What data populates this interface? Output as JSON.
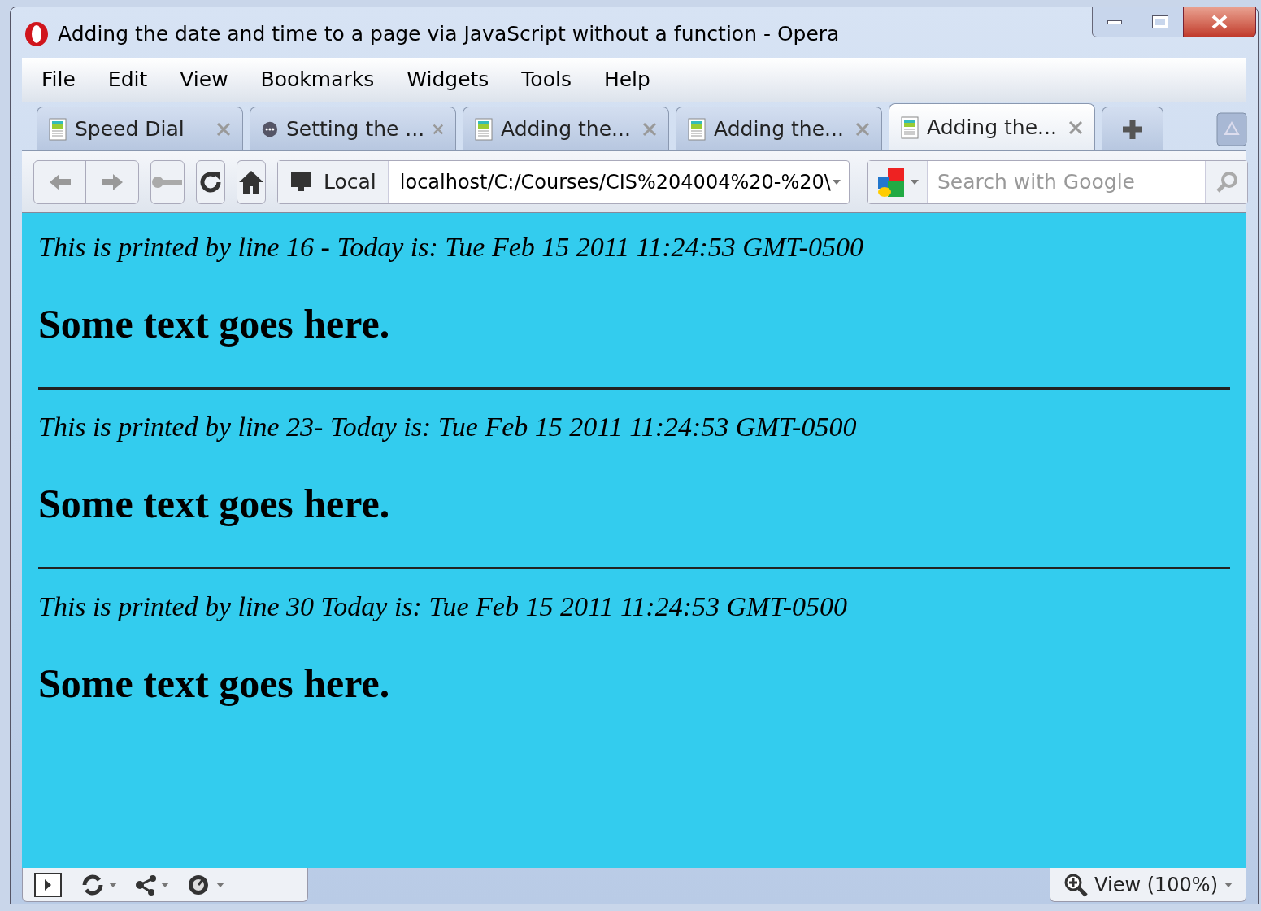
{
  "window": {
    "title": "Adding the date and time to a page via JavaScript without a function - Opera"
  },
  "menu": [
    "File",
    "Edit",
    "View",
    "Bookmarks",
    "Widgets",
    "Tools",
    "Help"
  ],
  "tabs": [
    {
      "label": "Speed Dial",
      "kind": "page",
      "selected": false
    },
    {
      "label": "Setting the ...",
      "kind": "chat",
      "selected": false
    },
    {
      "label": "Adding the...",
      "kind": "page",
      "selected": false
    },
    {
      "label": "Adding the...",
      "kind": "page",
      "selected": false
    },
    {
      "label": "Adding the...",
      "kind": "page",
      "selected": true
    }
  ],
  "address": {
    "badge": "Local",
    "value": "localhost/C:/Courses/CIS%204004%20-%20\\"
  },
  "search": {
    "placeholder": "Search with Google"
  },
  "content": [
    {
      "note": "This is printed by line 16 - Today is: Tue Feb 15 2011 11:24:53 GMT-0500",
      "heading": "Some text goes here.",
      "rule": true
    },
    {
      "note": "This is printed by line 23- Today is: Tue Feb 15 2011 11:24:53 GMT-0500",
      "heading": "Some text goes here.",
      "rule": true
    },
    {
      "note": "This is printed by line 30 Today is: Tue Feb 15 2011 11:24:53 GMT-0500",
      "heading": "Some text goes here.",
      "rule": false
    }
  ],
  "status_bar": {
    "zoom": "View (100%)"
  }
}
